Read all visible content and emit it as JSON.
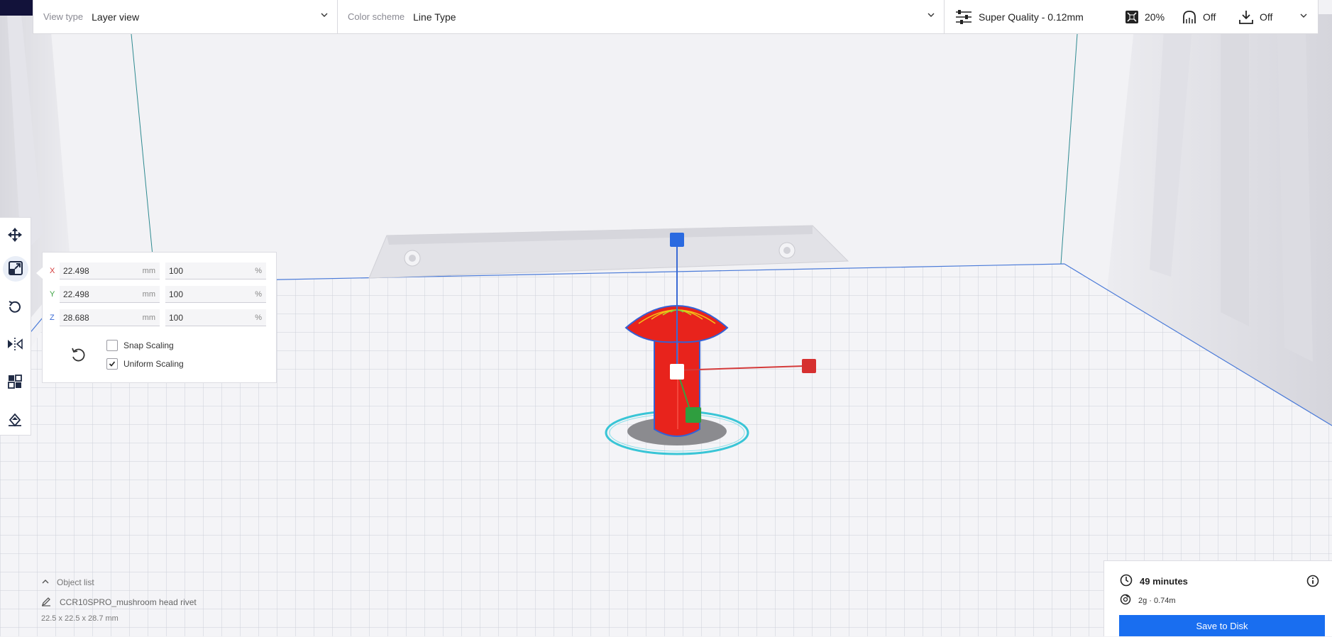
{
  "topbar": {
    "view_type_label": "View type",
    "view_type_value": "Layer view",
    "color_scheme_label": "Color scheme",
    "color_scheme_value": "Line Type",
    "profile": "Super Quality - 0.12mm",
    "infill": "20%",
    "support": "Off",
    "adhesion": "Off"
  },
  "left_toolbar": {
    "tools": [
      "move-icon",
      "scale-icon",
      "rotate-icon",
      "mirror-icon",
      "per-model-settings-icon",
      "support-blocker-icon"
    ],
    "active_tool": "scale-icon"
  },
  "scale_panel": {
    "x": {
      "axis": "X",
      "mm": "22.498",
      "unit_mm": "mm",
      "percent": "100",
      "unit_pct": "%"
    },
    "y": {
      "axis": "Y",
      "mm": "22.498",
      "unit_mm": "mm",
      "percent": "100",
      "unit_pct": "%"
    },
    "z": {
      "axis": "Z",
      "mm": "28.688",
      "unit_mm": "mm",
      "percent": "100",
      "unit_pct": "%"
    },
    "snap_scaling_label": "Snap Scaling",
    "snap_scaling_checked": false,
    "uniform_scaling_label": "Uniform Scaling",
    "uniform_scaling_checked": true
  },
  "object_list": {
    "header": "Object list",
    "item_name": "CCR10SPRO_mushroom head rivet",
    "dimensions": "22.5 x 22.5 x 28.7 mm"
  },
  "print_panel": {
    "time": "49 minutes",
    "material": "2g · 0.74m",
    "save_button": "Save to Disk"
  },
  "colors": {
    "accent_blue": "#196ef0",
    "model_red": "#e8231c",
    "axis_x": "#d43a3a",
    "axis_y": "#3aa040",
    "axis_z": "#3a6ad4"
  }
}
